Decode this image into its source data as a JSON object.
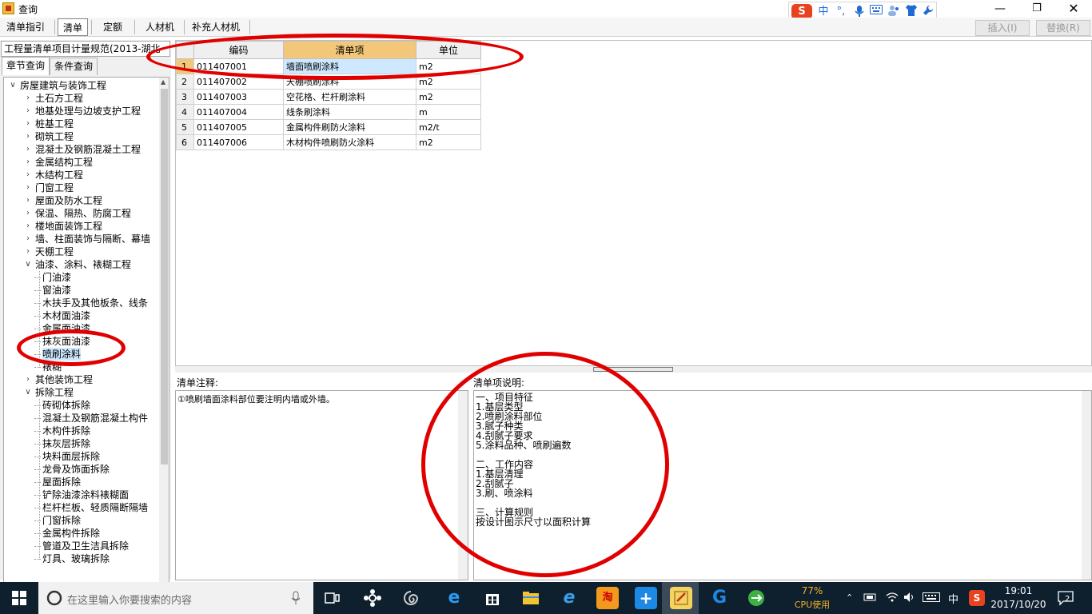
{
  "window": {
    "title": "查询"
  },
  "ime": {
    "logo": "S",
    "mode": "中",
    "punct": "°,",
    "items": [
      "mic-icon",
      "keyboard-icon",
      "user-icon",
      "shirt-icon",
      "wrench-icon"
    ]
  },
  "menu": {
    "tabs": [
      "清单指引",
      "清单",
      "定额",
      "人材机",
      "补充人材机"
    ],
    "active_tab": "清单",
    "insert_label": "插入(I)",
    "replace_label": "替换(R)"
  },
  "left": {
    "spec": "工程量清单项目计量规范(2013-湖北",
    "tabs": [
      "章节查询",
      "条件查询"
    ],
    "tree": [
      {
        "label": "房屋建筑与装饰工程",
        "level": 0,
        "expanded": true
      },
      {
        "label": "土石方工程",
        "level": 1
      },
      {
        "label": "地基处理与边坡支护工程",
        "level": 1
      },
      {
        "label": "桩基工程",
        "level": 1
      },
      {
        "label": "砌筑工程",
        "level": 1
      },
      {
        "label": "混凝土及钢筋混凝土工程",
        "level": 1
      },
      {
        "label": "金属结构工程",
        "level": 1
      },
      {
        "label": "木结构工程",
        "level": 1
      },
      {
        "label": "门窗工程",
        "level": 1
      },
      {
        "label": "屋面及防水工程",
        "level": 1
      },
      {
        "label": "保温、隔热、防腐工程",
        "level": 1
      },
      {
        "label": "楼地面装饰工程",
        "level": 1
      },
      {
        "label": "墙、柱面装饰与隔断、幕墙",
        "level": 1
      },
      {
        "label": "天棚工程",
        "level": 1
      },
      {
        "label": "油漆、涂料、裱糊工程",
        "level": 1,
        "expanded": true
      },
      {
        "label": "门油漆",
        "level": 2
      },
      {
        "label": "窗油漆",
        "level": 2
      },
      {
        "label": "木扶手及其他板条、线条",
        "level": 2
      },
      {
        "label": "木材面油漆",
        "level": 2
      },
      {
        "label": "金属面油漆",
        "level": 2
      },
      {
        "label": "抹灰面油漆",
        "level": 2
      },
      {
        "label": "喷刷涂料",
        "level": 2,
        "selected": true
      },
      {
        "label": "裱糊",
        "level": 2
      },
      {
        "label": "其他装饰工程",
        "level": 1
      },
      {
        "label": "拆除工程",
        "level": 1,
        "expanded": true
      },
      {
        "label": "砖砌体拆除",
        "level": 2
      },
      {
        "label": "混凝土及钢筋混凝土构件",
        "level": 2
      },
      {
        "label": "木构件拆除",
        "level": 2
      },
      {
        "label": "抹灰层拆除",
        "level": 2
      },
      {
        "label": "块料面层拆除",
        "level": 2
      },
      {
        "label": "龙骨及饰面拆除",
        "level": 2
      },
      {
        "label": "屋面拆除",
        "level": 2
      },
      {
        "label": "铲除油漆涂料裱糊面",
        "level": 2
      },
      {
        "label": "栏杆栏板、轻质隔断隔墙",
        "level": 2
      },
      {
        "label": "门窗拆除",
        "level": 2
      },
      {
        "label": "金属构件拆除",
        "level": 2
      },
      {
        "label": "管道及卫生洁具拆除",
        "level": 2
      },
      {
        "label": "灯具、玻璃拆除",
        "level": 2
      }
    ]
  },
  "grid": {
    "headers": [
      "",
      "编码",
      "清单项",
      "单位"
    ],
    "rows": [
      [
        "1",
        "011407001",
        "墙面喷刷涂料",
        "m2"
      ],
      [
        "2",
        "011407002",
        "天棚喷刷涂料",
        "m2"
      ],
      [
        "3",
        "011407003",
        "空花格、栏杆刷涂料",
        "m2"
      ],
      [
        "4",
        "011407004",
        "线条刷涂料",
        "m"
      ],
      [
        "5",
        "011407005",
        "金属构件刷防火涂料",
        "m2/t"
      ],
      [
        "6",
        "011407006",
        "木材构件喷刷防火涂料",
        "m2"
      ]
    ]
  },
  "notes": {
    "label": "清单注释:",
    "text": "①喷刷墙面涂料部位要注明内墙或外墙。"
  },
  "description": {
    "label": "清单项说明:",
    "lines": [
      "一、项目特征",
      "1.基层类型",
      "2.喷刷涂料部位",
      "3.腻子种类",
      "4.刮腻子要求",
      "5.涂料品种、喷刷遍数",
      "",
      "二、工作内容",
      "1.基层清理",
      "2.刮腻子",
      "3.刷、喷涂料",
      "",
      "三、计算规则",
      " 按设计图示尺寸以面积计算"
    ]
  },
  "taskbar": {
    "search_placeholder": "在这里输入你要搜索的内容",
    "cpu_percent": "77%",
    "cpu_label": "CPU使用",
    "ime_mode": "中",
    "time": "19:01",
    "date": "2017/10/20",
    "notifications": "2"
  },
  "colors": {
    "header_highlight": "#f3c77a",
    "selection": "#cde8ff",
    "annotation": "#e00000",
    "taskbar": "#0e1f2e"
  }
}
